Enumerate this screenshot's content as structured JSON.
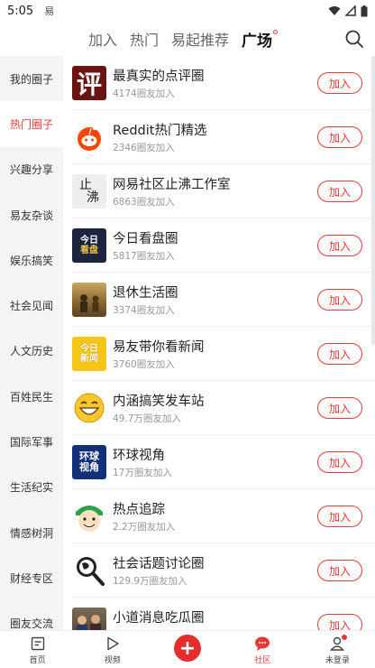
{
  "status": {
    "time": "5:05",
    "app_glyph": "易"
  },
  "top_tabs": [
    {
      "label": "加入",
      "active": false
    },
    {
      "label": "热门",
      "active": false
    },
    {
      "label": "易起推荐",
      "active": false
    },
    {
      "label": "广场",
      "active": true
    }
  ],
  "sidebar": {
    "items": [
      {
        "label": "我的圈子"
      },
      {
        "label": "热门圈子"
      },
      {
        "label": "兴趣分享"
      },
      {
        "label": "易友杂谈"
      },
      {
        "label": "娱乐搞笑"
      },
      {
        "label": "社会见闻"
      },
      {
        "label": "人文历史"
      },
      {
        "label": "百姓民生"
      },
      {
        "label": "国际军事"
      },
      {
        "label": "生活纪实"
      },
      {
        "label": "情感树洞"
      },
      {
        "label": "财经专区"
      },
      {
        "label": "圈友交流"
      }
    ],
    "active": "热门圈子"
  },
  "circles": [
    {
      "title": "最真实的点评圈",
      "members": "4174圈友加入",
      "icon": "ping-logo-icon",
      "join": "加入"
    },
    {
      "title": "Reddit热门精选",
      "members": "2346圈友加入",
      "icon": "reddit-logo-icon",
      "join": "加入"
    },
    {
      "title": "网易社区止沸工作室",
      "members": "6863圈友加入",
      "icon": "zhifei-calligraphy-icon",
      "join": "加入"
    },
    {
      "title": "今日看盘圈",
      "members": "5817圈友加入",
      "icon": "jinri-kanpan-icon",
      "join": "加入"
    },
    {
      "title": "退休生活圈",
      "members": "3374圈友加入",
      "icon": "retirement-photo-icon",
      "join": "加入"
    },
    {
      "title": "易友带你看新闻",
      "members": "3760圈友加入",
      "icon": "jinri-xinwen-icon",
      "join": "加入"
    },
    {
      "title": "内涵搞笑发车站",
      "members": "49.7万圈友加入",
      "icon": "laughing-emoji-icon",
      "join": "加入"
    },
    {
      "title": "环球视角",
      "members": "17万圈友加入",
      "icon": "huanqiu-shijiao-icon",
      "join": "加入"
    },
    {
      "title": "热点追踪",
      "members": "2.2万圈友加入",
      "icon": "cartoon-face-icon",
      "join": "加入"
    },
    {
      "title": "社会话题讨论圈",
      "members": "129.9万圈友加入",
      "icon": "magnifier-globe-icon",
      "join": "加入"
    },
    {
      "title": "小道消息吃瓜圈",
      "members": "",
      "icon": "crowd-photo-icon",
      "join": "加入"
    }
  ],
  "icon_text": {
    "ping": "评",
    "zhifei": [
      "止",
      "沸"
    ],
    "kanpan": [
      "今日",
      "看盘"
    ],
    "xinwen": [
      "今日",
      "新闻"
    ],
    "huanqiu": [
      "环球",
      "视角"
    ]
  },
  "bottom_nav": [
    {
      "label": "首页",
      "icon": "home-doc-icon",
      "active": false
    },
    {
      "label": "视频",
      "icon": "play-icon",
      "active": false
    },
    {
      "label": "",
      "icon": "plus-icon",
      "active": false
    },
    {
      "label": "社区",
      "icon": "community-bubble-icon",
      "active": true
    },
    {
      "label": "未登录",
      "icon": "user-icon",
      "active": false
    }
  ],
  "colors": {
    "accent": "#e53a3a",
    "sidebar_bg": "#f4f4f4",
    "divider": "#eeeeee"
  }
}
